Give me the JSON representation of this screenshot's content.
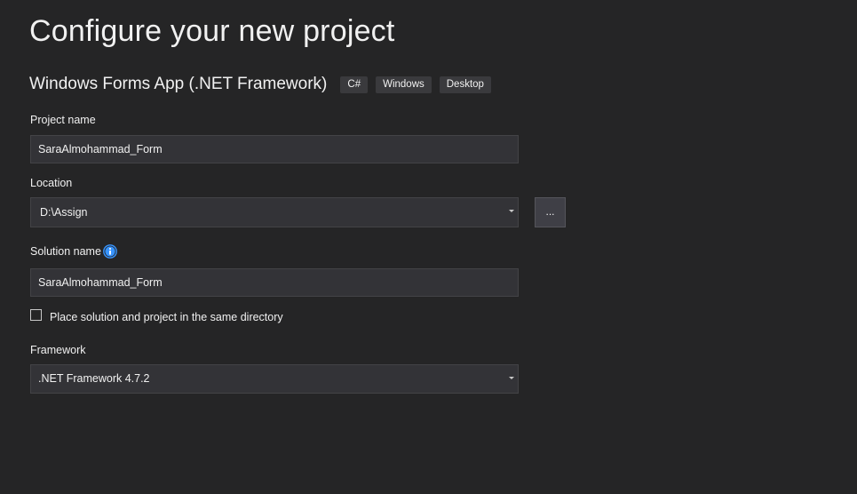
{
  "page": {
    "title": "Configure your new project",
    "template_name": "Windows Forms App (.NET Framework)",
    "tags": [
      "C#",
      "Windows",
      "Desktop"
    ]
  },
  "project_name": {
    "label": "Project name",
    "value": "SaraAlmohammad_Form"
  },
  "location": {
    "label": "Location",
    "value": "D:\\Assign",
    "browse_label": "..."
  },
  "solution_name": {
    "label": "Solution name",
    "value": "SaraAlmohammad_Form",
    "info_icon": "info-icon"
  },
  "same_directory": {
    "label": "Place solution and project in the same directory",
    "checked": false
  },
  "framework": {
    "label": "Framework",
    "value": ".NET Framework 4.7.2"
  },
  "colors": {
    "background": "#252526",
    "field_bg": "#333337",
    "field_border": "#434346",
    "tag_bg": "#3a3a3d",
    "info_blue": "#3794ff"
  }
}
